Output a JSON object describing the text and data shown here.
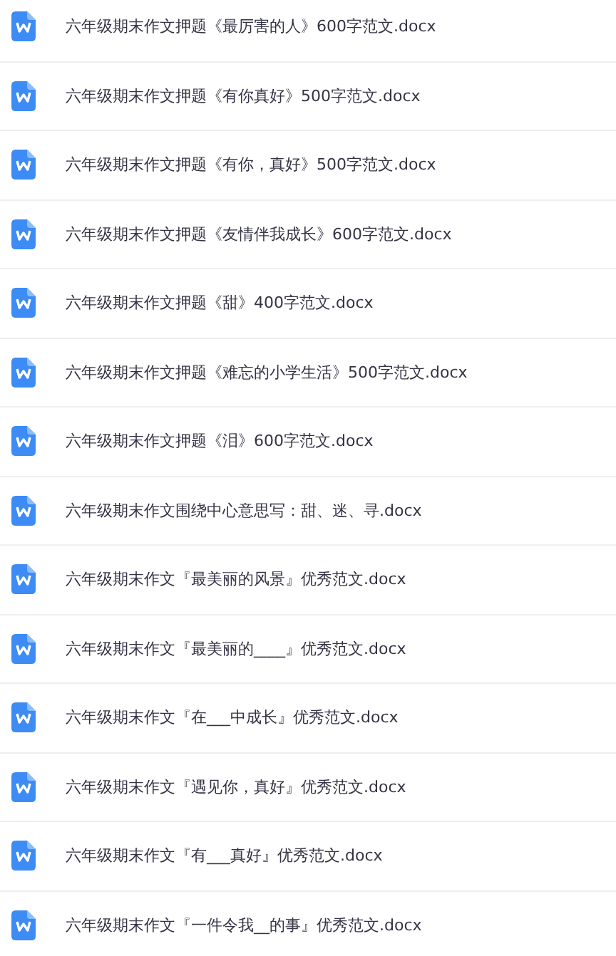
{
  "files": [
    {
      "name": "六年级期末作文押题《最厉害的人》600字范文.docx"
    },
    {
      "name": "六年级期末作文押题《有你真好》500字范文.docx"
    },
    {
      "name": "六年级期末作文押题《有你，真好》500字范文.docx"
    },
    {
      "name": "六年级期末作文押题《友情伴我成长》600字范文.docx"
    },
    {
      "name": "六年级期末作文押题《甜》400字范文.docx"
    },
    {
      "name": "六年级期末作文押题《难忘的小学生活》500字范文.docx"
    },
    {
      "name": "六年级期末作文押题《泪》600字范文.docx"
    },
    {
      "name": "六年级期末作文围绕中心意思写：甜、迷、寻.docx"
    },
    {
      "name": "六年级期末作文『最美丽的风景』优秀范文.docx"
    },
    {
      "name": "六年级期末作文『最美丽的____』优秀范文.docx"
    },
    {
      "name": "六年级期末作文『在___中成长』优秀范文.docx"
    },
    {
      "name": "六年级期末作文『遇见你，真好』优秀范文.docx"
    },
    {
      "name": "六年级期末作文『有___真好』优秀范文.docx"
    },
    {
      "name": "六年级期末作文『一件令我__的事』优秀范文.docx"
    }
  ]
}
